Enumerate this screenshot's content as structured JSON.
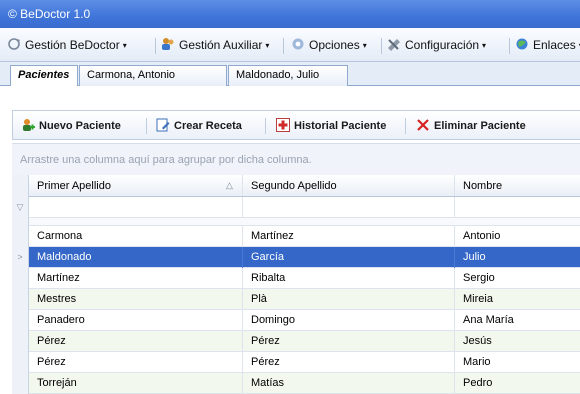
{
  "window": {
    "title": "© BeDoctor 1.0"
  },
  "menu": [
    {
      "label": "Gestión BeDoctor",
      "icon": "refresh-icon"
    },
    {
      "label": "Gestión Auxiliar",
      "icon": "people-icon"
    },
    {
      "label": "Opciones",
      "icon": "gear-icon"
    },
    {
      "label": "Configuración",
      "icon": "tools-icon"
    },
    {
      "label": "Enlaces",
      "icon": "globe-icon"
    }
  ],
  "tabs": [
    {
      "label": "Pacientes",
      "active": true
    },
    {
      "label": "Carmona, Antonio",
      "active": false
    },
    {
      "label": "Maldonado, Julio",
      "active": false
    }
  ],
  "toolbar": {
    "new_patient": "Nuevo Paciente",
    "create_prescription": "Crear Receta",
    "patient_history": "Historial Paciente",
    "delete_patient": "Eliminar Paciente"
  },
  "grid": {
    "group_hint": "Arrastre una columna aquí para agrupar por dicha columna.",
    "columns": [
      "Primer Apellido",
      "Segundo Apellido",
      "Nombre"
    ],
    "rows": [
      [
        "Carmona",
        "Martínez",
        "Antonio"
      ],
      [
        "Maldonado",
        "García",
        "Julio"
      ],
      [
        "Martínez",
        "Ribalta",
        "Sergio"
      ],
      [
        "Mestres",
        "Plà",
        "Mireia"
      ],
      [
        "Panadero",
        "Domingo",
        "Ana María"
      ],
      [
        "Pérez",
        "Pérez",
        "Jesús"
      ],
      [
        "Pérez",
        "Pérez",
        "Mario"
      ],
      [
        "Torreján",
        "Matías",
        "Pedro"
      ]
    ],
    "selected_row": 1
  }
}
